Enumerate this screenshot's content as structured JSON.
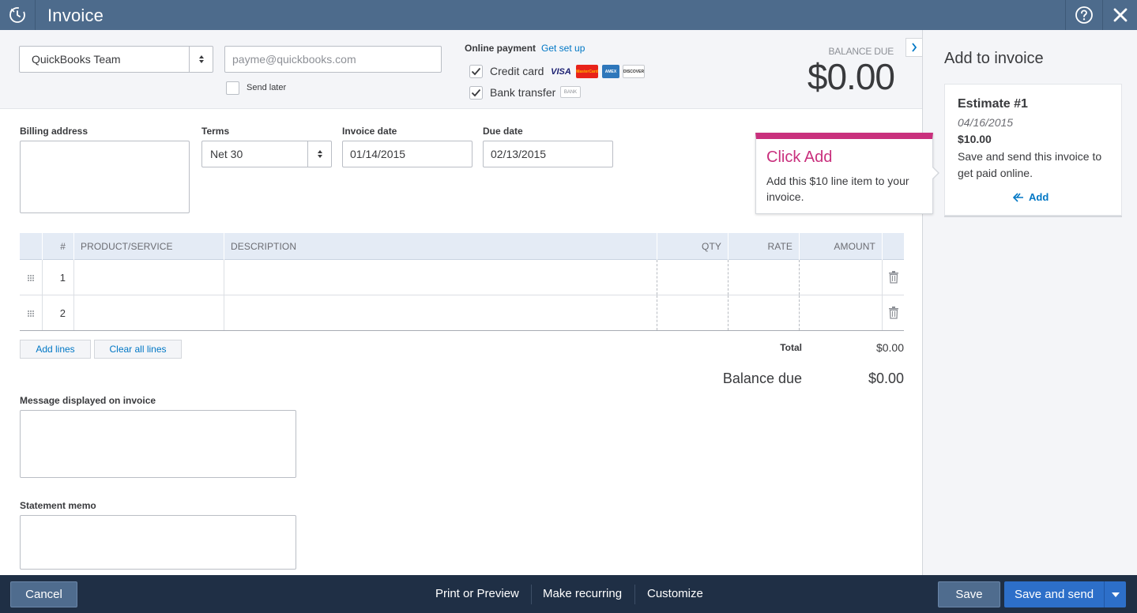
{
  "header": {
    "title": "Invoice",
    "logo_icon": "refresh-circle-icon",
    "help_icon": "help-icon",
    "close_icon": "close-icon"
  },
  "customer": {
    "selected": "QuickBooks Team",
    "email_placeholder": "payme@quickbooks.com",
    "send_later_label": "Send later"
  },
  "online_payment": {
    "label": "Online payment",
    "setup_link": "Get set up",
    "credit_card_label": "Credit card",
    "bank_transfer_label": "Bank transfer",
    "card_logos": [
      "VISA",
      "MasterCard",
      "AMEX",
      "DISCOVER"
    ],
    "bank_logo": "BANK"
  },
  "balance_due": {
    "label": "BALANCE DUE",
    "amount": "$0.00"
  },
  "fields": {
    "billing_address_label": "Billing address",
    "terms_label": "Terms",
    "terms_value": "Net 30",
    "invoice_date_label": "Invoice date",
    "invoice_date_value": "01/14/2015",
    "due_date_label": "Due date",
    "due_date_value": "02/13/2015"
  },
  "table": {
    "headers": {
      "num": "#",
      "product": "PRODUCT/SERVICE",
      "description": "DESCRIPTION",
      "qty": "QTY",
      "rate": "RATE",
      "amount": "AMOUNT"
    },
    "rows": [
      {
        "num": "1"
      },
      {
        "num": "2"
      }
    ]
  },
  "table_actions": {
    "add_lines": "Add lines",
    "clear_all": "Clear all lines"
  },
  "totals": {
    "total_label": "Total",
    "total_value": "$0.00",
    "balance_label": "Balance due",
    "balance_value": "$0.00"
  },
  "message": {
    "label": "Message displayed on invoice"
  },
  "memo": {
    "label": "Statement memo"
  },
  "tooltip": {
    "title": "Click Add",
    "body": "Add this $10 line item to your invoice."
  },
  "side_panel": {
    "title": "Add to invoice",
    "estimate": {
      "title": "Estimate #1",
      "date": "04/16/2015",
      "amount": "$10.00",
      "description": "Save and send this invoice to get paid online.",
      "add_label": "Add"
    }
  },
  "footer": {
    "cancel": "Cancel",
    "print_preview": "Print or Preview",
    "make_recurring": "Make recurring",
    "customize": "Customize",
    "save": "Save",
    "save_and_send": "Save and send"
  },
  "colors": {
    "header_bg": "#4d6b8c",
    "footer_bg": "#1f2f45",
    "accent_pink": "#c9307d",
    "link_blue": "#0077c5",
    "primary_button": "#2d6fc9"
  }
}
